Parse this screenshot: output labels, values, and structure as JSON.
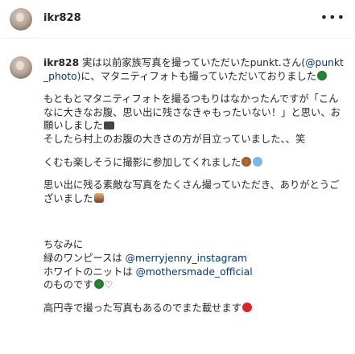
{
  "header": {
    "username": "ikr828",
    "more_icon": "more-horizontal-icon"
  },
  "post": {
    "username": "ikr828",
    "p1_a": "実は以前家族写真を撮っていただいたpunkt.さん(",
    "p1_mention": "@punkt_photo",
    "p1_b": ")に、マタニティフォトも撮っていただいておりました",
    "p2_a": "もともとマタニティフォトを撮るつもりはなかったんですが「こんなに大きなお腹、思い出に残さなきゃもったいない！」と思い、お願いしました",
    "p2_b": "そしたら村上のお腹の大きさの方が目立っていました、、笑",
    "p3": "くむも楽しそうに撮影に参加してくれました",
    "p4": "思い出に残る素敵な写真をたくさん撮っていただき、ありがとうございました",
    "p5_line1": "ちなみに",
    "p5_line2_a": "緑のワンピースは ",
    "p5_line2_mention": "@merryjenny_instagram",
    "p5_line3_a": "ホワイトのニットは ",
    "p5_line3_mention": "@mothersmade_official",
    "p5_line4": "のものです",
    "p6": "高円寺で撮った写真もあるのでまた載せます"
  },
  "icons": {
    "clover": "clover-emoji-icon",
    "camera": "camera-emoji-icon",
    "bear": "bear-emoji-icon",
    "snowflake": "snowflake-emoji-icon",
    "person": "person-emoji-icon",
    "heart": "heart-icon",
    "red_circle": "red-circle-emoji-icon"
  }
}
